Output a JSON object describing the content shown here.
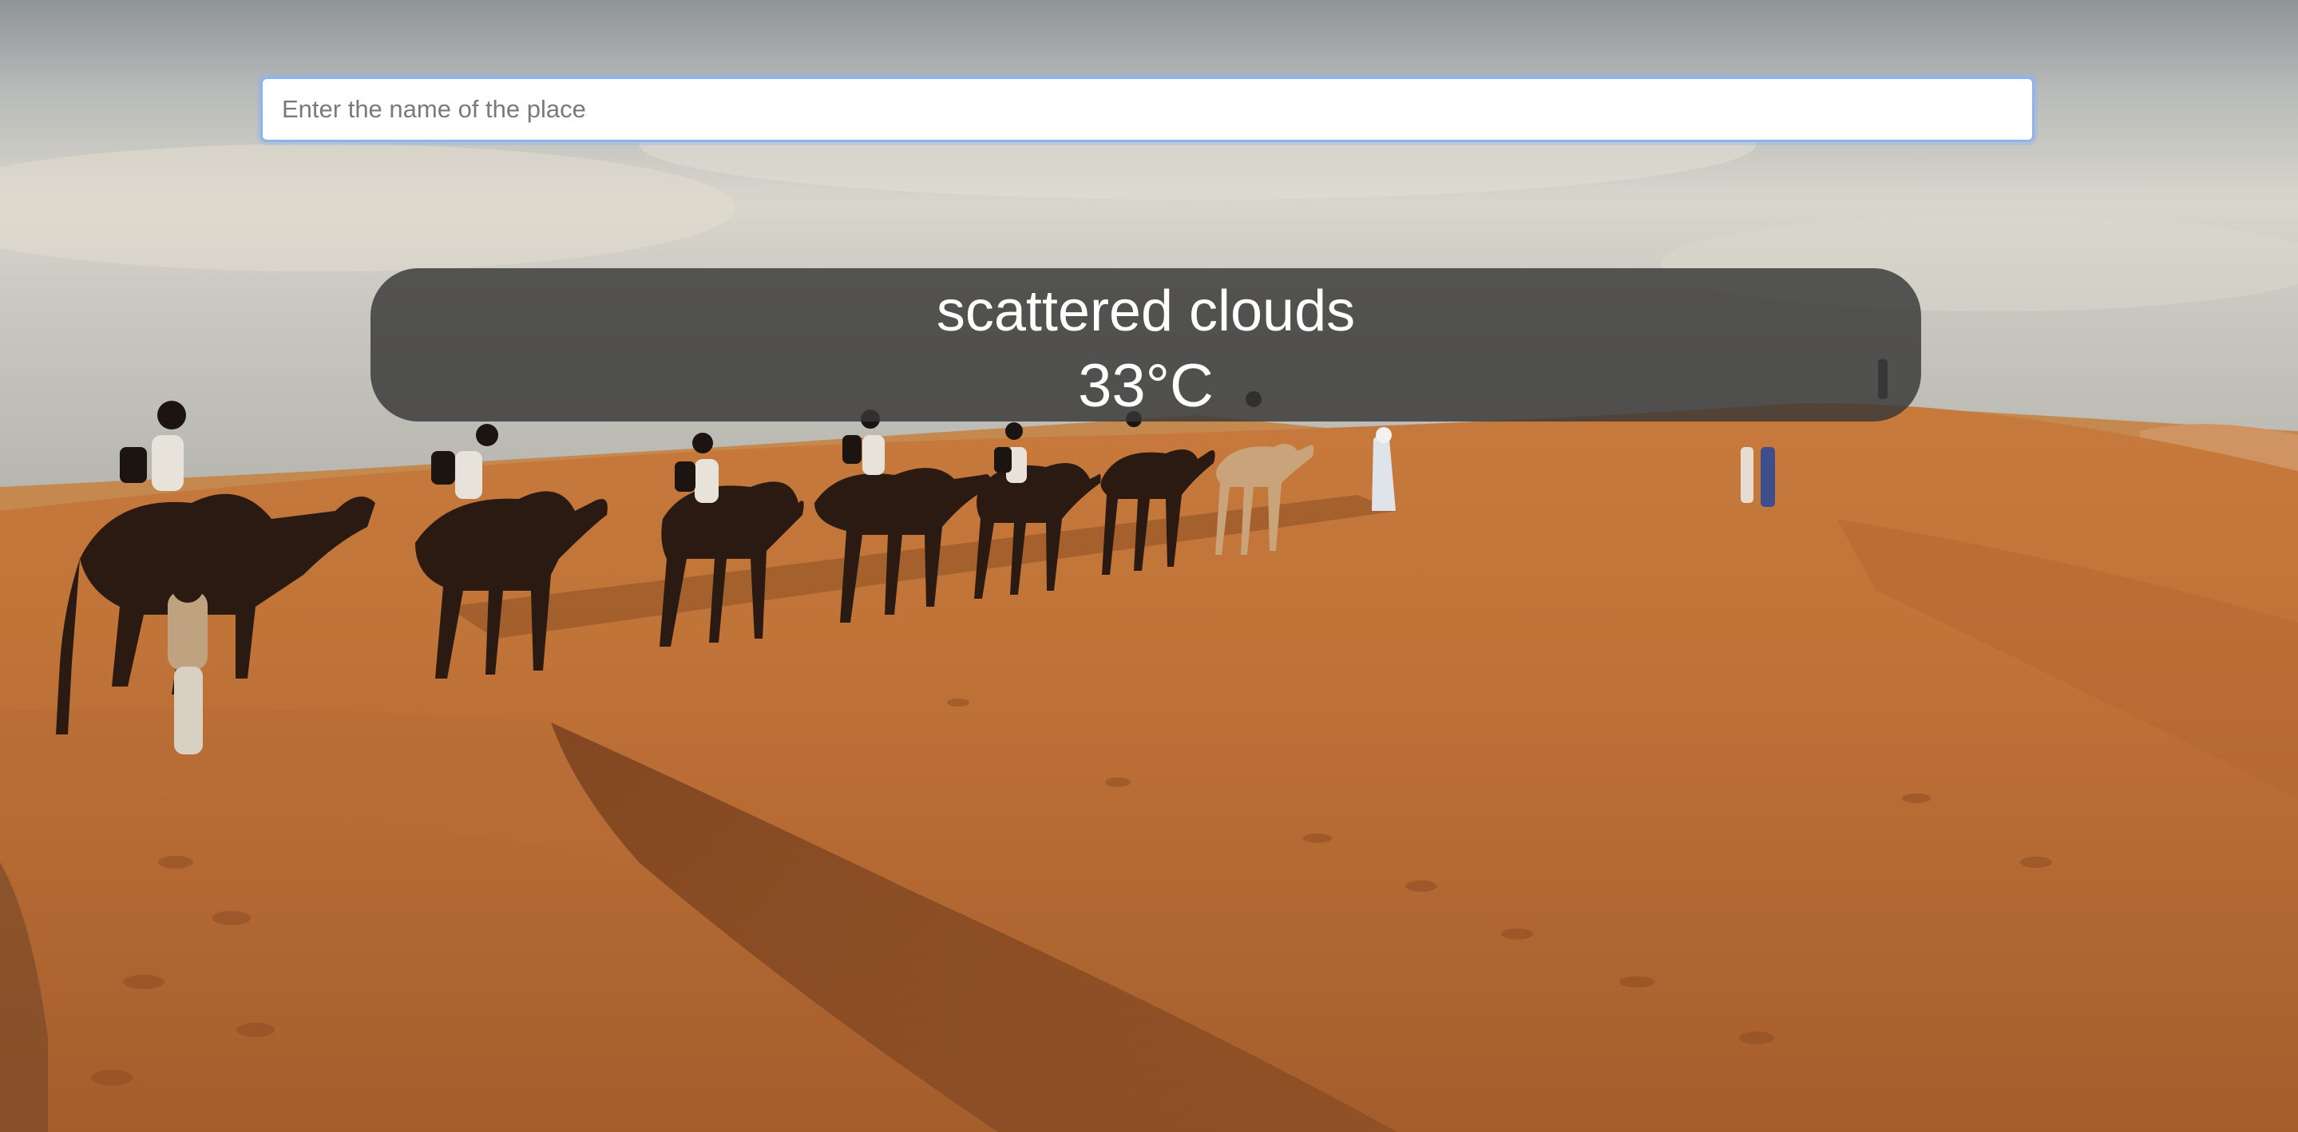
{
  "search": {
    "placeholder": "Enter the name of the place",
    "value": ""
  },
  "weather": {
    "description": "scattered clouds",
    "temperature": "33°C"
  },
  "background": {
    "icon": "desert-camel-caravan-photo"
  },
  "colors": {
    "card_bg": "#373737",
    "input_border": "#8fb3ee",
    "sand": "#c0773f",
    "sky": "#d3d3cf"
  }
}
